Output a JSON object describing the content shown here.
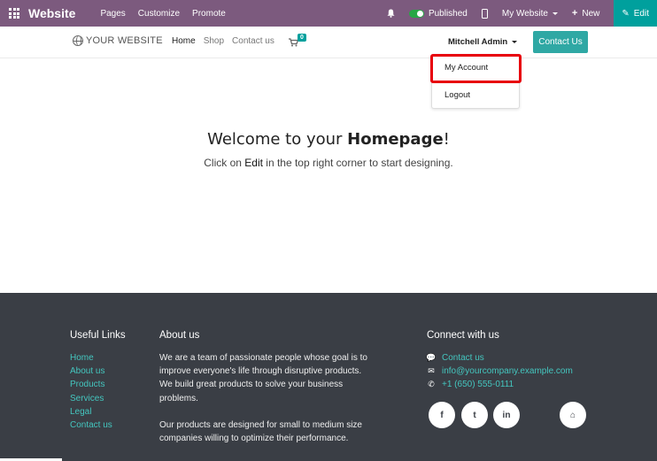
{
  "topbar": {
    "app_name": "Website",
    "nav": [
      "Pages",
      "Customize",
      "Promote"
    ],
    "published_label": "Published",
    "my_website_label": "My Website",
    "new_label": "New",
    "edit_label": "Edit",
    "plus_glyph": "+",
    "edit_glyph": "✎",
    "bell_glyph": "🔔"
  },
  "sitenav": {
    "logo_text": "YOUR WEBSITE",
    "menu": [
      "Home",
      "Shop",
      "Contact us"
    ],
    "cart_count": "0",
    "user_name": "Mitchell Admin",
    "contact_button": "Contact Us"
  },
  "dropdown": {
    "items": [
      "My Account",
      "Logout"
    ]
  },
  "hero": {
    "title_prefix": "Welcome to your ",
    "title_bold": "Homepage",
    "title_suffix": "!",
    "sub_prefix": "Click on ",
    "sub_em": "Edit",
    "sub_suffix": " in the top right corner to start designing."
  },
  "footer": {
    "useful_links_title": "Useful Links",
    "useful_links": [
      "Home",
      "About us",
      "Products",
      "Services",
      "Legal",
      "Contact us"
    ],
    "about_title": "About us",
    "about_p1": "We are a team of passionate people whose goal is to improve everyone's life through disruptive products. We build great products to solve your business problems.",
    "about_p2": "Our products are designed for small to medium size companies willing to optimize their performance.",
    "connect_title": "Connect with us",
    "contacts": [
      {
        "icon": "chat-icon",
        "glyph": "💬",
        "text": "Contact us"
      },
      {
        "icon": "envelope-icon",
        "glyph": "✉",
        "text": "info@yourcompany.example.com"
      },
      {
        "icon": "phone-icon",
        "glyph": "✆",
        "text": "+1 (650) 555-0111"
      }
    ],
    "social": [
      {
        "icon": "facebook-icon",
        "glyph": "f"
      },
      {
        "icon": "twitter-icon",
        "glyph": "t"
      },
      {
        "icon": "linkedin-icon",
        "glyph": "in"
      },
      {
        "icon": "home-icon",
        "glyph": "⌂"
      }
    ]
  },
  "colors": {
    "topbar": "#7c5a7e",
    "accent": "#00a09d",
    "footer": "#3a3e45",
    "highlight": "#e8000b"
  }
}
